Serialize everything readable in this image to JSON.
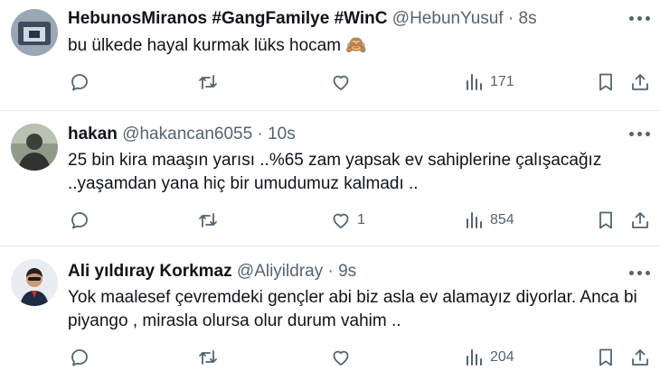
{
  "tweets": [
    {
      "name": "HebunosMiranos #GangFamilye #WinC",
      "handle": "@HebunYusuf",
      "separator": "·",
      "time": "8s",
      "lines": [
        "bu ülkede hayal kurmak lüks hocam 🙈"
      ],
      "replies": "",
      "retweets": "",
      "likes": "",
      "views": "171"
    },
    {
      "name": "hakan",
      "handle": "@hakancan6055",
      "separator": "·",
      "time": "10s",
      "lines": [
        "25 bin kira maaşın yarısı ..%65 zam yapsak ev sahiplerine çalışacağız",
        "..yaşamdan yana hiç bir umudumuz kalmadı .."
      ],
      "replies": "",
      "retweets": "",
      "likes": "1",
      "views": "854"
    },
    {
      "name": "Ali yıldıray Korkmaz",
      "handle": "@Aliyildray",
      "separator": "·",
      "time": "9s",
      "lines": [
        "Yok maalesef çevremdeki gençler abi biz asla ev alamayız diyorlar. Anca bi",
        "piyango , mirasla olursa olur durum vahim .."
      ],
      "replies": "",
      "retweets": "",
      "likes": "",
      "views": "204"
    }
  ],
  "icons": {
    "reply": "reply-icon",
    "retweet": "retweet-icon",
    "like": "heart-icon",
    "views": "views-chart-icon",
    "bookmark": "bookmark-icon",
    "share": "share-icon",
    "more": "more-dots-icon"
  },
  "colors": {
    "text": "#0f1419",
    "secondary": "#536471",
    "divider": "#e6e9ec"
  }
}
